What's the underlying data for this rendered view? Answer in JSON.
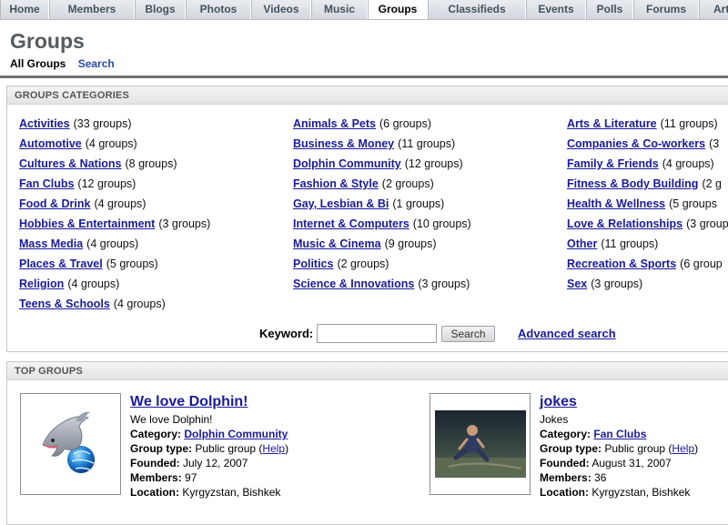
{
  "nav": {
    "tabs": [
      {
        "label": "Home"
      },
      {
        "label": "Members"
      },
      {
        "label": "Blogs"
      },
      {
        "label": "Photos"
      },
      {
        "label": "Videos"
      },
      {
        "label": "Music"
      },
      {
        "label": "Groups",
        "active": true
      },
      {
        "label": "Classifieds"
      },
      {
        "label": "Events"
      },
      {
        "label": "Polls"
      },
      {
        "label": "Forums"
      },
      {
        "label": "Art"
      }
    ]
  },
  "header": {
    "title": "Groups",
    "subnav": {
      "current": "All Groups",
      "search": "Search"
    }
  },
  "categories": {
    "heading": "GROUPS CATEGORIES",
    "items": [
      {
        "name": "Activities",
        "count": "(33 groups)"
      },
      {
        "name": "Automotive",
        "count": "(4 groups)"
      },
      {
        "name": "Cultures & Nations",
        "count": "(8 groups)"
      },
      {
        "name": "Fan Clubs",
        "count": "(12 groups)"
      },
      {
        "name": "Food & Drink",
        "count": "(4 groups)"
      },
      {
        "name": "Hobbies & Entertainment",
        "count": "(3 groups)"
      },
      {
        "name": "Mass Media",
        "count": "(4 groups)"
      },
      {
        "name": "Places & Travel",
        "count": "(5 groups)"
      },
      {
        "name": "Religion",
        "count": "(4 groups)"
      },
      {
        "name": "Teens & Schools",
        "count": "(4 groups)"
      },
      {
        "name": "Animals & Pets",
        "count": "(6 groups)"
      },
      {
        "name": "Business & Money",
        "count": "(11 groups)"
      },
      {
        "name": "Dolphin Community",
        "count": "(12 groups)"
      },
      {
        "name": "Fashion & Style",
        "count": "(2 groups)"
      },
      {
        "name": "Gay, Lesbian & Bi",
        "count": "(1 groups)"
      },
      {
        "name": "Internet & Computers",
        "count": "(10 groups)"
      },
      {
        "name": "Music & Cinema",
        "count": "(9 groups)"
      },
      {
        "name": "Politics",
        "count": "(2 groups)"
      },
      {
        "name": "Science & Innovations",
        "count": "(3 groups)"
      },
      {
        "name": "Arts & Literature",
        "count": "(11 groups)"
      },
      {
        "name": "Companies & Co-workers",
        "count": "(3"
      },
      {
        "name": "Family & Friends",
        "count": "(4 groups)"
      },
      {
        "name": "Fitness & Body Building",
        "count": "(2 g"
      },
      {
        "name": "Health & Wellness",
        "count": "(5 groups"
      },
      {
        "name": "Love & Relationships",
        "count": "(3 groups"
      },
      {
        "name": "Other",
        "count": "(11 groups)"
      },
      {
        "name": "Recreation & Sports",
        "count": "(6 group"
      },
      {
        "name": "Sex",
        "count": "(3 groups)"
      }
    ]
  },
  "search": {
    "keyword_label": "Keyword:",
    "keyword_value": "",
    "button_label": "Search",
    "advanced_label": "Advanced search"
  },
  "top_groups": {
    "heading": "TOP GROUPS",
    "category_label": "Category:",
    "type_label": "Group type:",
    "help_label": "Help",
    "founded_label": "Founded:",
    "members_label": "Members:",
    "location_label": "Location:",
    "groups": [
      {
        "name": "We love Dolphin!",
        "description": "We love Dolphin!",
        "category": "Dolphin Community",
        "type": "Public group",
        "founded": "July 12, 2007",
        "members": "97",
        "location": "Kyrgyzstan, Bishkek",
        "thumb_icon": "dolphin-logo-icon"
      },
      {
        "name": "jokes",
        "description": "Jokes",
        "category": "Fan Clubs",
        "type": "Public group",
        "founded": "August 31, 2007",
        "members": "36",
        "location": "Kyrgyzstan, Bishkek",
        "thumb_icon": "person-photo"
      }
    ]
  }
}
